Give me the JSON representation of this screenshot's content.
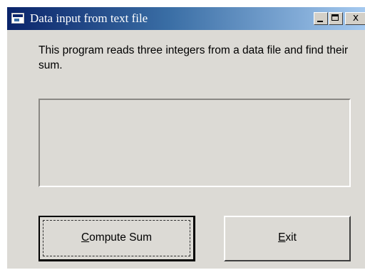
{
  "window": {
    "title": "Data input from text file",
    "controls": {
      "minimize_icon": "minimize-icon",
      "maximize_icon": "maximize-icon",
      "close_glyph": "x"
    }
  },
  "main": {
    "description": "This program reads three integers from a data file and find their sum.",
    "result_text": ""
  },
  "buttons": {
    "compute": {
      "mnemonic": "C",
      "rest": "ompute Sum"
    },
    "exit": {
      "mnemonic": "E",
      "rest": "xit"
    }
  },
  "colors": {
    "window_bg": "#dcdad5",
    "titlebar_start": "#0a246a",
    "titlebar_end": "#a6caf0",
    "title_text": "#ffffff"
  }
}
